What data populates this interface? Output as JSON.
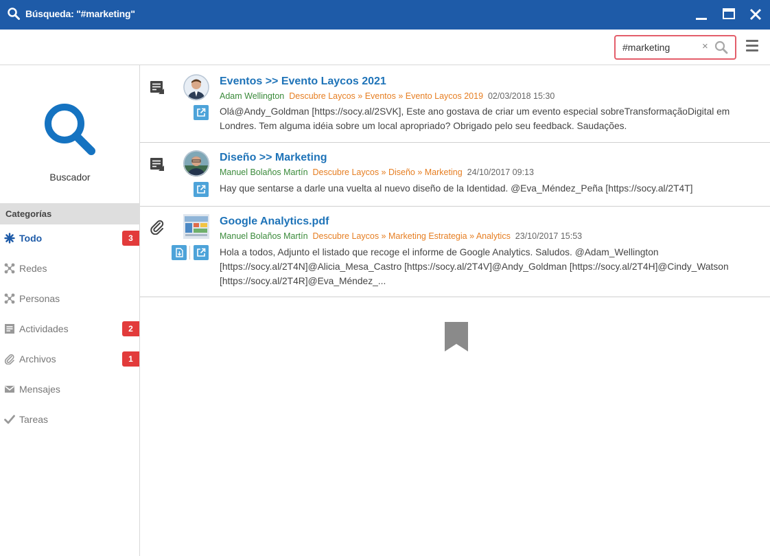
{
  "window": {
    "title": "Búsqueda: \"#marketing\""
  },
  "toolbar": {
    "search_value": "#marketing",
    "search_clear": "×"
  },
  "sidebar": {
    "label": "Buscador",
    "categories_header": "Categorías",
    "items": [
      {
        "label": "Todo",
        "icon": "asterisk-icon",
        "badge": "3",
        "active": true
      },
      {
        "label": "Redes",
        "icon": "network-icon",
        "badge": "",
        "active": false
      },
      {
        "label": "Personas",
        "icon": "people-icon",
        "badge": "",
        "active": false
      },
      {
        "label": "Actividades",
        "icon": "activity-icon",
        "badge": "2",
        "active": false
      },
      {
        "label": "Archivos",
        "icon": "paperclip-icon",
        "badge": "1",
        "active": false
      },
      {
        "label": "Mensajes",
        "icon": "envelope-icon",
        "badge": "",
        "active": false
      },
      {
        "label": "Tareas",
        "icon": "checkmark-icon",
        "badge": "",
        "active": false
      }
    ]
  },
  "results": [
    {
      "type_icon": "activity-icon",
      "title": "Eventos >> Evento Laycos 2021",
      "author": "Adam Wellington",
      "path": "Descubre Laycos » Eventos » Evento Laycos 2019",
      "date": "02/03/2018 15:30",
      "body_lines": [
        "Olá@Andy_Goldman [https://socy.al/2SVK], Este ano gostava de criar um evento especial sobreTransformaçãoDigital em",
        "Londres. Tem alguma idéia sobre um local apropriado? Obrigado pelo seu feedback. Saudações."
      ]
    },
    {
      "type_icon": "activity-icon",
      "title": "Diseño >> Marketing",
      "author": "Manuel Bolaños Martín",
      "path": "Descubre Laycos » Diseño » Marketing",
      "date": "24/10/2017 09:13",
      "body_lines": [
        "Hay que sentarse a darle una vuelta al nuevo diseño de la Identidad. @Eva_Méndez_Peña [https://socy.al/2T4T]"
      ]
    },
    {
      "type_icon": "paperclip-icon",
      "title": "Google Analytics.pdf",
      "author": "Manuel Bolaños Martín",
      "path": "Descubre Laycos » Marketing Estrategia » Analytics",
      "date": "23/10/2017 15:53",
      "body_lines": [
        "Hola a todos, Adjunto el listado que recoge el informe de Google Analytics. Saludos. @Adam_Wellington",
        "[https://socy.al/2T4N]@Alicia_Mesa_Castro [https://socy.al/2T4V]@Andy_Goldman [https://socy.al/2T4H]@Cindy_Watson",
        "[https://socy.al/2T4R]@Eva_Méndez_..."
      ]
    }
  ],
  "colors": {
    "titlebar": "#1e5ba8",
    "link": "#1e73b8",
    "author": "#3a8a3a",
    "path": "#e67e22",
    "badge": "#e23b3b",
    "action_button": "#4da3d9",
    "search_highlight": "#e35d6a"
  }
}
